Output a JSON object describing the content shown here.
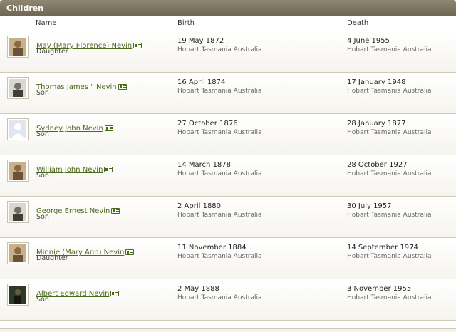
{
  "panel": {
    "title": "Children"
  },
  "columns": {
    "name": "Name",
    "birth": "Birth",
    "death": "Death"
  },
  "children": [
    {
      "name": "May (Mary Florence) Nevin",
      "relation": "Daughter",
      "birth_date": "19 May 1872",
      "birth_place": "Hobart Tasmania Australia",
      "death_date": "4 June 1955",
      "death_place": "Hobart Tasmania Australia",
      "photo": "sepia-portrait"
    },
    {
      "name": "Thomas James \" Nevin",
      "relation": "Son",
      "birth_date": "16 April 1874",
      "birth_place": "Hobart Tasmania Australia",
      "death_date": "17 January 1948",
      "death_place": "Hobart Tasmania Australia",
      "photo": "bw-portrait"
    },
    {
      "name": "Sydney John Nevin",
      "relation": "Son",
      "birth_date": "27 October 1876",
      "birth_place": "Hobart Tasmania Australia",
      "death_date": "28 January 1877",
      "death_place": "Hobart Tasmania Australia",
      "photo": "placeholder-silhouette"
    },
    {
      "name": "William John Nevin",
      "relation": "Son",
      "birth_date": "14 March 1878",
      "birth_place": "Hobart Tasmania Australia",
      "death_date": "28 October 1927",
      "death_place": "Hobart Tasmania Australia",
      "photo": "sepia-portrait"
    },
    {
      "name": "George Ernest Nevin",
      "relation": "Son",
      "birth_date": "2 April 1880",
      "birth_place": "Hobart Tasmania Australia",
      "death_date": "30 July 1957",
      "death_place": "Hobart Tasmania Australia",
      "photo": "bw-portrait"
    },
    {
      "name": "Minnie (Mary Ann) Nevin",
      "relation": "Daughter",
      "birth_date": "11 November 1884",
      "birth_place": "Hobart Tasmania Australia",
      "death_date": "14 September 1974",
      "death_place": "Hobart Tasmania Australia",
      "photo": "sepia-portrait"
    },
    {
      "name": "Albert Edward Nevin",
      "relation": "Son",
      "birth_date": "2 May 1888",
      "birth_place": "Hobart Tasmania Australia",
      "death_date": "3 November 1955",
      "death_place": "Hobart Tasmania Australia",
      "photo": "dark-portrait"
    }
  ],
  "colors": {
    "link": "#4a6a1c",
    "header": "#7a735e"
  }
}
